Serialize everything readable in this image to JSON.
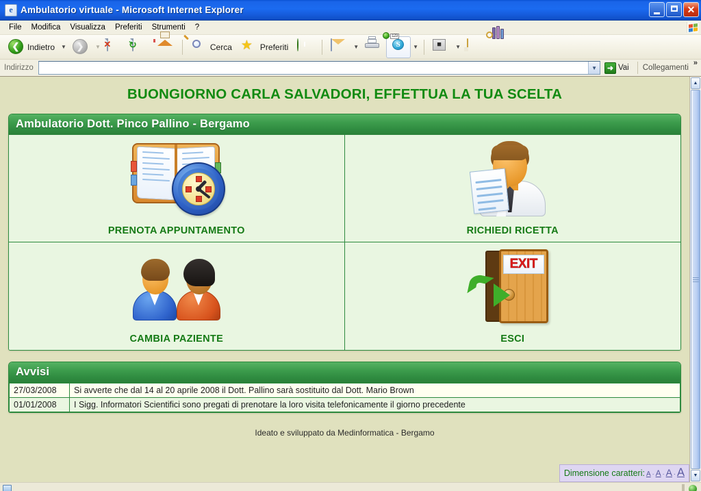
{
  "window": {
    "title": "Ambulatorio virtuale - Microsoft Internet Explorer",
    "app_icon": "ie-icon",
    "minimize_label": "Riduci a icona",
    "restore_label": "Ripristino",
    "close_label": "Chiudi"
  },
  "menubar": {
    "items": [
      {
        "label": "File"
      },
      {
        "label": "Modifica"
      },
      {
        "label": "Visualizza"
      },
      {
        "label": "Preferiti"
      },
      {
        "label": "Strumenti"
      },
      {
        "label": "?"
      }
    ]
  },
  "toolbar": {
    "back_label": "Indietro",
    "search_label": "Cerca",
    "favorites_label": "Preferiti",
    "icons": [
      "back-icon",
      "forward-icon",
      "stop-icon",
      "refresh-icon",
      "home-icon",
      "search-icon",
      "favorites-star-icon",
      "history-icon",
      "mail-icon",
      "print-icon",
      "skype-icon",
      "excel-icon",
      "note-icon",
      "research-icon"
    ]
  },
  "address_bar": {
    "label": "Indirizzo",
    "value": "",
    "placeholder": "",
    "go_label": "Vai",
    "links_label": "Collegamenti",
    "overflow_chevron": "»"
  },
  "page": {
    "welcome": "BUONGIORNO CARLA SALVADORI, EFFETTUA LA TUA SCELTA",
    "panel_title": "Ambulatorio Dott. Pinco Pallino - Bergamo",
    "tiles": [
      {
        "label": "PRENOTA APPUNTAMENTO",
        "icon": "book-clock-icon"
      },
      {
        "label": "RICHIEDI RICETTA",
        "icon": "doctor-prescription-icon"
      },
      {
        "label": "CAMBIA PAZIENTE",
        "icon": "two-users-icon"
      },
      {
        "label": "ESCI",
        "icon": "exit-door-icon"
      }
    ],
    "exit_sign_text": "EXIT",
    "notices_title": "Avvisi",
    "notices": [
      {
        "date": "27/03/2008",
        "text": "Si avverte che dal 14 al 20 aprile 2008 il Dott. Pallino sarà sostituito dal Dott. Mario Brown"
      },
      {
        "date": "01/01/2008",
        "text": "I Sigg. Informatori Scientifici sono pregati di prenotare la loro visita telefonicamente il giorno precedente"
      }
    ],
    "footer": "Ideato e sviluppato da Medinformatica - Bergamo",
    "font_size_widget": {
      "label": "Dimensione caratteri:",
      "options": [
        "A",
        "A",
        "A",
        "A"
      ],
      "separator": "·"
    }
  },
  "colors": {
    "brand_green": "#2d8a3e",
    "header_green": "#3c9c4c",
    "text_green": "#157a15",
    "page_bg": "#e0e1be",
    "panel_bg": "#e9f6e1",
    "titlebar_blue": "#1b6bf0"
  },
  "scrollbar": {
    "up_arrow": "▲",
    "down_arrow": "▼"
  }
}
